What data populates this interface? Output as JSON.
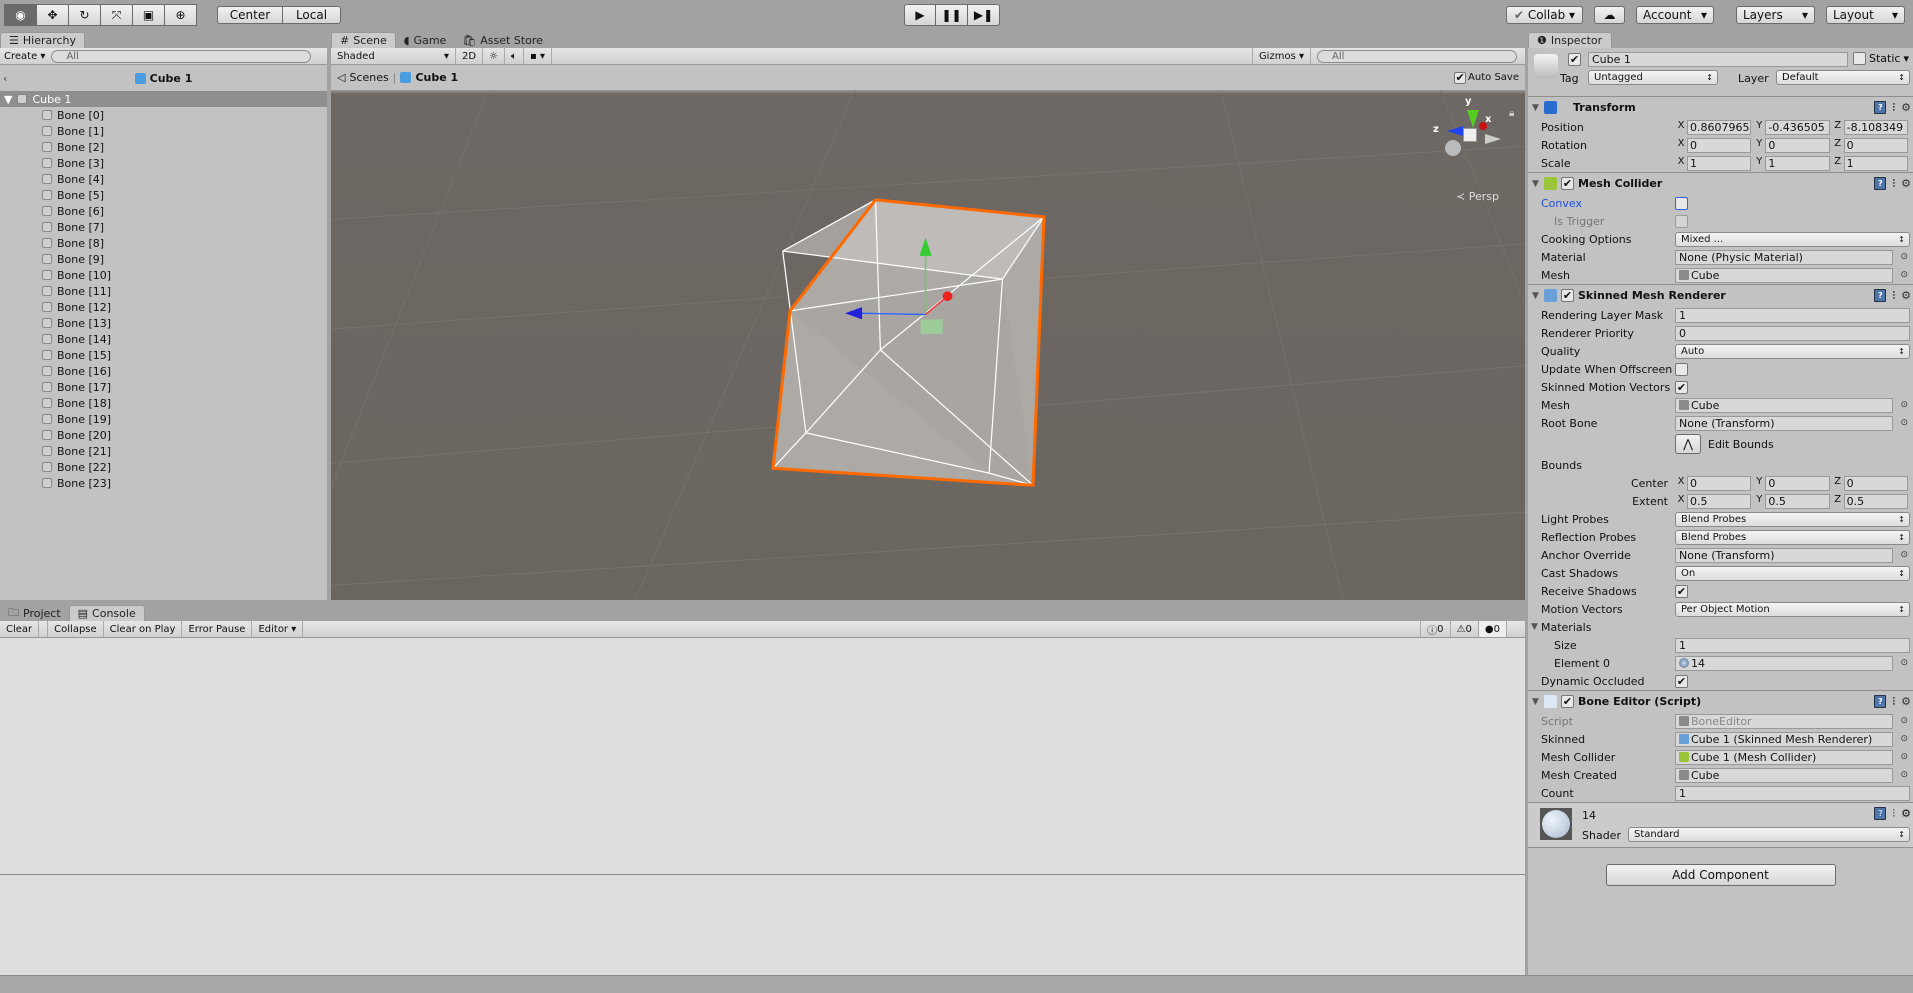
{
  "toolbar": {
    "tools": [
      {
        "name": "view-tool",
        "glyph": "◉"
      },
      {
        "name": "move-tool",
        "glyph": "✥"
      },
      {
        "name": "rotate-tool",
        "glyph": "↻"
      },
      {
        "name": "scale-tool",
        "glyph": "⤧"
      },
      {
        "name": "rect-tool",
        "glyph": "▣"
      },
      {
        "name": "transform-tool",
        "glyph": "⊕"
      }
    ],
    "pivot": "Center",
    "space": "Local",
    "collab": "Collab",
    "account": "Account",
    "layers": "Layers",
    "layout": "Layout"
  },
  "hierarchy": {
    "tab": "Hierarchy",
    "create": "Create",
    "search_placeholder": "All",
    "breadcrumb": "Cube 1",
    "root": "Cube 1",
    "items": [
      "Bone [0]",
      "Bone [1]",
      "Bone [2]",
      "Bone [3]",
      "Bone [4]",
      "Bone [5]",
      "Bone [6]",
      "Bone [7]",
      "Bone [8]",
      "Bone [9]",
      "Bone [10]",
      "Bone [11]",
      "Bone [12]",
      "Bone [13]",
      "Bone [14]",
      "Bone [15]",
      "Bone [16]",
      "Bone [17]",
      "Bone [18]",
      "Bone [19]",
      "Bone [20]",
      "Bone [21]",
      "Bone [22]",
      "Bone [23]"
    ]
  },
  "scene": {
    "tabs": [
      "Scene",
      "Game",
      "Asset Store"
    ],
    "shading": "Shaded",
    "mode_2d": "2D",
    "gizmos": "Gizmos",
    "search_placeholder": "All",
    "breadcrumb_scenes": "Scenes",
    "breadcrumb_object": "Cube 1",
    "auto_save": "Auto Save",
    "persp": "Persp",
    "axis_x": "x",
    "axis_y": "y",
    "axis_z": "z",
    "selection_color": "#ff6a00"
  },
  "console": {
    "tabs": [
      "Project",
      "Console"
    ],
    "buttons": [
      "Clear",
      "Collapse",
      "Clear on Play",
      "Error Pause"
    ],
    "editor": "Editor",
    "info_count": "0",
    "warn_count": "0",
    "error_count": "0"
  },
  "inspector": {
    "tab": "Inspector",
    "object_name": "Cube 1",
    "static_label": "Static",
    "tag_label": "Tag",
    "tag": "Untagged",
    "layer_label": "Layer",
    "layer": "Default",
    "components": [
      {
        "name": "Transform",
        "icon": "transform-icon",
        "color": "#2a6bd0",
        "checkbox": false,
        "rows": [
          {
            "t": "vec3",
            "label": "Position",
            "v": [
              "0.8607965",
              "-0.436505",
              "-8.108349"
            ]
          },
          {
            "t": "vec3",
            "label": "Rotation",
            "v": [
              "0",
              "0",
              "0"
            ]
          },
          {
            "t": "vec3",
            "label": "Scale",
            "v": [
              "1",
              "1",
              "1"
            ]
          }
        ]
      },
      {
        "name": "Mesh Collider",
        "icon": "mesh-collider-icon",
        "color": "#9ac43a",
        "checkbox": true,
        "rows": [
          {
            "t": "check",
            "label": "Convex",
            "v": false,
            "blue": true
          },
          {
            "t": "check",
            "label": "Is Trigger",
            "v": false,
            "indent": true,
            "disabled": true
          },
          {
            "t": "dd",
            "label": "Cooking Options",
            "v": "Mixed ..."
          },
          {
            "t": "obj",
            "label": "Material",
            "v": "None (Physic Material)"
          },
          {
            "t": "obj",
            "label": "Mesh",
            "v": "Cube",
            "icon": "mesh-icon"
          }
        ]
      },
      {
        "name": "Skinned Mesh Renderer",
        "icon": "skinned-mesh-renderer-icon",
        "color": "#6aa0d8",
        "checkbox": true,
        "rows": [
          {
            "t": "text",
            "label": "Rendering Layer Mask",
            "v": "1"
          },
          {
            "t": "text",
            "label": "Renderer Priority",
            "v": "0"
          },
          {
            "t": "dd",
            "label": "Quality",
            "v": "Auto"
          },
          {
            "t": "check",
            "label": "Update When Offscreen",
            "v": false
          },
          {
            "t": "check",
            "label": "Skinned Motion Vectors",
            "v": true
          },
          {
            "t": "obj",
            "label": "Mesh",
            "v": "Cube",
            "icon": "mesh-icon"
          },
          {
            "t": "obj",
            "label": "Root Bone",
            "v": "None (Transform)"
          },
          {
            "t": "button",
            "label": "",
            "v": "Edit Bounds"
          },
          {
            "t": "label",
            "label": "Bounds"
          },
          {
            "t": "vec3",
            "label": "Center",
            "v": [
              "0",
              "0",
              "0"
            ],
            "right": true
          },
          {
            "t": "vec3",
            "label": "Extent",
            "v": [
              "0.5",
              "0.5",
              "0.5"
            ],
            "right": true
          },
          {
            "t": "dd",
            "label": "Light Probes",
            "v": "Blend Probes"
          },
          {
            "t": "dd",
            "label": "Reflection Probes",
            "v": "Blend Probes"
          },
          {
            "t": "obj",
            "label": "Anchor Override",
            "v": "None (Transform)"
          },
          {
            "t": "dd",
            "label": "Cast Shadows",
            "v": "On"
          },
          {
            "t": "check",
            "label": "Receive Shadows",
            "v": true
          },
          {
            "t": "dd",
            "label": "Motion Vectors",
            "v": "Per Object Motion"
          },
          {
            "t": "fold",
            "label": "Materials"
          },
          {
            "t": "text",
            "label": "Size",
            "v": "1",
            "indent": true
          },
          {
            "t": "obj",
            "label": "Element 0",
            "v": "14",
            "indent": true,
            "icon": "material-icon"
          },
          {
            "t": "check",
            "label": "Dynamic Occluded",
            "v": true
          }
        ]
      },
      {
        "name": "Bone Editor (Script)",
        "icon": "script-icon",
        "color": "#dfe8f5",
        "checkbox": true,
        "rows": [
          {
            "t": "obj",
            "label": "Script",
            "v": "BoneEditor",
            "disabled": true,
            "icon": "script-icon"
          },
          {
            "t": "obj",
            "label": "Skinned",
            "v": "Cube 1 (Skinned Mesh Renderer)",
            "icon": "skinned-mesh-renderer-icon"
          },
          {
            "t": "obj",
            "label": "Mesh Collider",
            "v": "Cube 1 (Mesh Collider)",
            "icon": "mesh-collider-icon"
          },
          {
            "t": "obj",
            "label": "Mesh Created",
            "v": "Cube",
            "icon": "mesh-icon"
          },
          {
            "t": "text",
            "label": "Count",
            "v": "1"
          }
        ]
      }
    ],
    "material": {
      "name": "14",
      "shader_label": "Shader",
      "shader": "Standard"
    },
    "add_component": "Add Component"
  }
}
